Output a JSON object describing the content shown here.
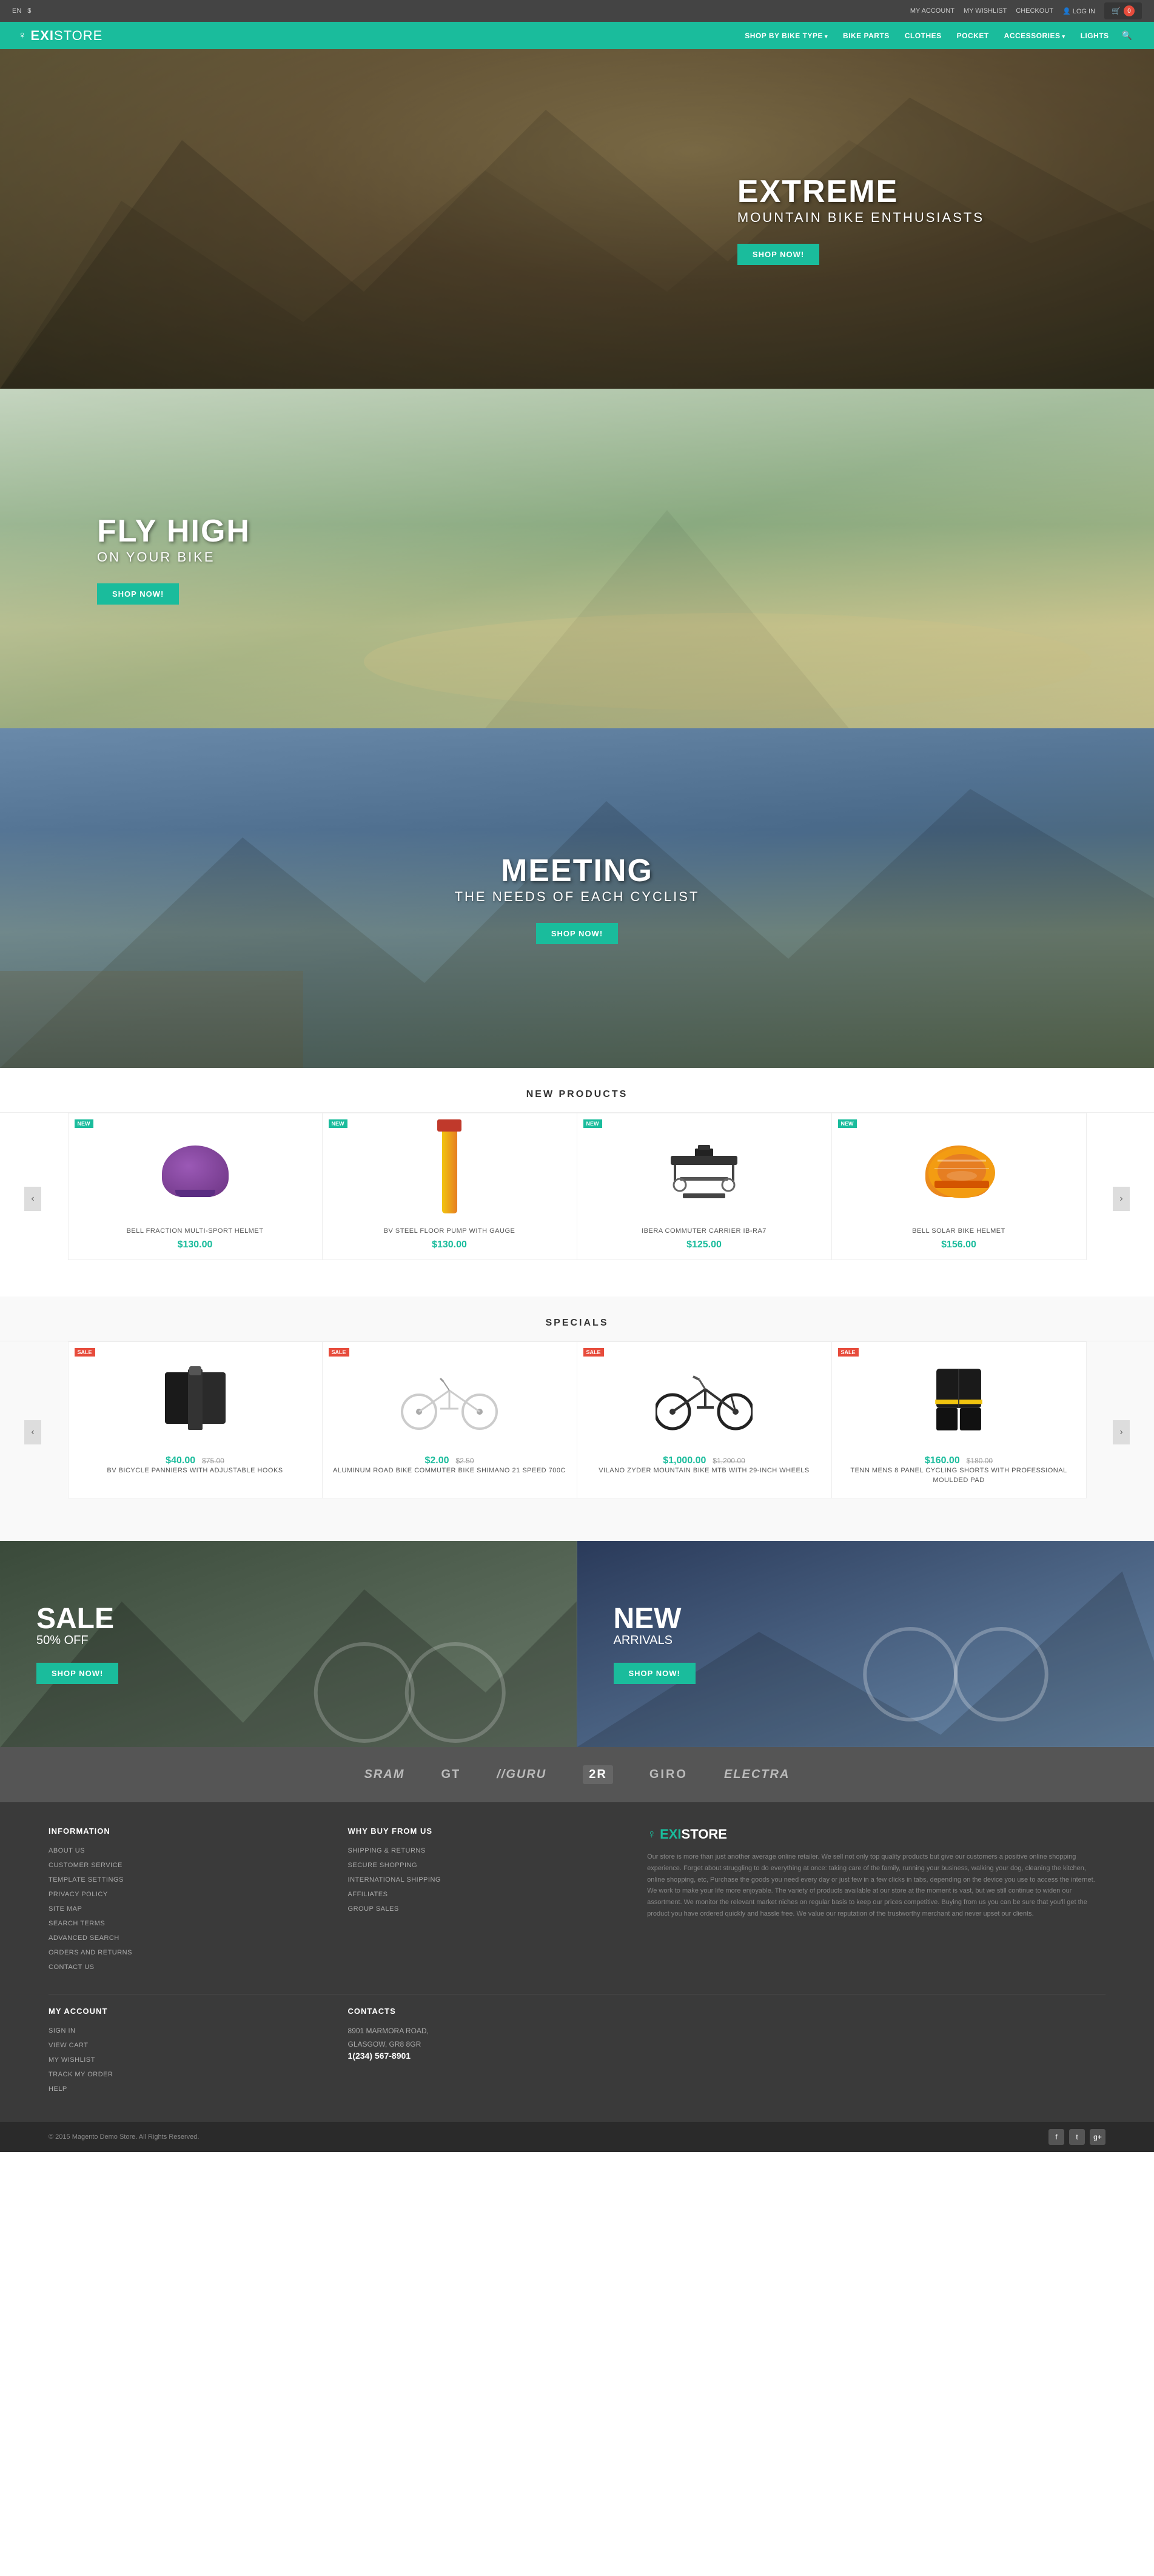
{
  "topbar": {
    "language": "EN",
    "currency": "$",
    "links": [
      "MY ACCOUNT",
      "MY WISHLIST",
      "CHECKOUT",
      "LOG IN"
    ],
    "cart_icon": "🛒",
    "cart_count": "0"
  },
  "header": {
    "logo_icon": "♀",
    "logo_exi": "EXI",
    "logo_store": "STORE",
    "nav": [
      {
        "label": "SHOP BY BIKE TYPE",
        "dropdown": true
      },
      {
        "label": "BIKE PARTS",
        "dropdown": false
      },
      {
        "label": "CLOTHES",
        "dropdown": false
      },
      {
        "label": "POCKET",
        "dropdown": false
      },
      {
        "label": "ACCESSORIES",
        "dropdown": true
      },
      {
        "label": "LIGHTS",
        "dropdown": false
      }
    ]
  },
  "hero1": {
    "title": "EXTREME",
    "subtitle": "MOUNTAIN BIKE ENTHUSIASTS",
    "button": "SHOP NOW!"
  },
  "hero2": {
    "title": "FLY HIGH",
    "subtitle": "ON YOUR BIKE",
    "button": "SHOP NOW!"
  },
  "hero3": {
    "title": "MEETING",
    "subtitle": "THE NEEDS OF EACH CYCLIST",
    "button": "SHOP NOW!"
  },
  "new_products": {
    "section_title": "NEW PRODUCTS",
    "products": [
      {
        "name": "BELL FRACTION MULTI-SPORT HELMET",
        "price": "$130.00",
        "badge": "NEW",
        "badge_color": "teal"
      },
      {
        "name": "BV STEEL FLOOR PUMP WITH GAUGE",
        "price": "$130.00",
        "badge": "NEW",
        "badge_color": "teal"
      },
      {
        "name": "IBERA COMMUTER CARRIER IB-RA7",
        "price": "$125.00",
        "badge": "NEW",
        "badge_color": "teal"
      },
      {
        "name": "BELL SOLAR BIKE HELMET",
        "price": "$156.00",
        "badge": "NEW",
        "badge_color": "teal"
      }
    ]
  },
  "specials": {
    "section_title": "SPECIALS",
    "products": [
      {
        "name": "BV BICYCLE PANNIERS WITH ADJUSTABLE HOOKS",
        "price": "$40.00",
        "price_old": "$75.00",
        "badge": "SALE",
        "badge_color": "red"
      },
      {
        "name": "ALUMINUM ROAD BIKE COMMUTER BIKE SHIMANO 21 SPEED 700C",
        "price": "$2.00",
        "price_old": "$2.50",
        "badge": "SALE",
        "badge_color": "red"
      },
      {
        "name": "VILANO ZYDER MOUNTAIN BIKE MTB WITH 29-INCH WHEELS",
        "price": "$1,000.00",
        "price_old": "$1,200.00",
        "badge": "SALE",
        "badge_color": "red"
      },
      {
        "name": "TENN MENS 8 PANEL CYCLING SHORTS WITH PROFESSIONAL MOULDED PAD",
        "price": "$160.00",
        "price_old": "$180.00",
        "badge": "SALE",
        "badge_color": "red"
      }
    ]
  },
  "promo_left": {
    "tag": "SALE",
    "sub": "50% OFF",
    "button": "SHOP NOW!"
  },
  "promo_right": {
    "tag": "NEW",
    "sub": "ARRIVALS",
    "button": "SHOP NOW!"
  },
  "brands": [
    "SRAM",
    "GT",
    "GURU",
    "2R",
    "GIRO",
    "Electra"
  ],
  "footer": {
    "info_title": "INFORMATION",
    "info_links": [
      "ABOUT US",
      "CUSTOMER SERVICE",
      "TEMPLATE SETTINGS",
      "PRIVACY POLICY",
      "SITE MAP",
      "SEARCH TERMS",
      "ADVANCED SEARCH",
      "ORDERS AND RETURNS",
      "CONTACT US"
    ],
    "why_title": "WHY BUY FROM US",
    "why_links": [
      "SHIPPING & RETURNS",
      "SECURE SHOPPING",
      "INTERNATIONAL SHIPPING",
      "AFFILIATES",
      "GROUP SALES"
    ],
    "logo_icon": "♀",
    "logo_text_exi": "EXI",
    "logo_text_store": "STORE",
    "about_text": "Our store is more than just another average online retailer. We sell not only top quality products but give our customers a positive online shopping experience. Forget about struggling to do everything at once: taking care of the family, running your business, walking your dog, cleaning the kitchen, online shopping, etc, Purchase the goods you need every day or just few in a few clicks in tabs, depending on the device you use to access the internet. We work to make your life more enjoyable. The variety of products available at our store at the moment is vast, but we still continue to widen our assortment. We monitor the relevant market niches on regular basis to keep our prices competitive. Buying from us you can be sure that you'll get the product you have ordered quickly and hassle free. We value our reputation of the trustworthy merchant and never upset our clients.",
    "account_title": "MY ACCOUNT",
    "account_links": [
      "SIGN IN",
      "VIEW CART",
      "MY WISHLIST",
      "TRACK MY ORDER",
      "HELP"
    ],
    "contacts_title": "CONTACTS",
    "address": "8901 MARMORA ROAD,\nGLASGOW, GR8 8GR",
    "phone": "1(234) 567-8901",
    "copyright": "© 2015 Magento Demo Store. All Rights Reserved.",
    "social": [
      "f",
      "t",
      "g+"
    ]
  }
}
